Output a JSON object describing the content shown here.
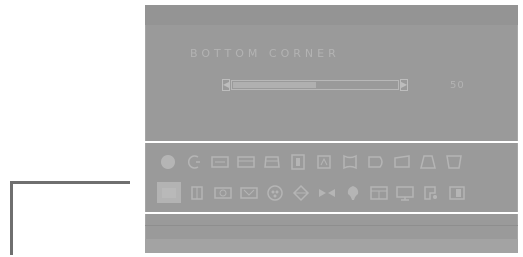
{
  "osd": {
    "title": "BOTTOM CORNER",
    "value": "50",
    "slider_fraction": 0.5,
    "left_arrow": "◀",
    "right_arrow": "▶"
  },
  "icons": {
    "row1": [
      "circle-icon",
      "pincushion-icon",
      "trapezoid-icon",
      "rotation-icon",
      "parallelogram-icon",
      "width-icon",
      "height-icon",
      "side-pin-icon",
      "key-balance-icon",
      "corner-icon",
      "top-corner-icon",
      "bottom-corner-icon"
    ],
    "row2": [
      "zoom-icon",
      "h-position-icon",
      "moire-icon",
      "degauss-icon",
      "color-icon",
      "convergence-icon",
      "h-moire-icon",
      "language-icon",
      "recall-icon",
      "osd-position-icon",
      "input-icon",
      "exit-icon"
    ]
  },
  "colors": {
    "panel": "#9a9a9a",
    "panel_text": "#b3b3b3",
    "bracket": "#ffffff",
    "leader": "#6f6f6f"
  }
}
